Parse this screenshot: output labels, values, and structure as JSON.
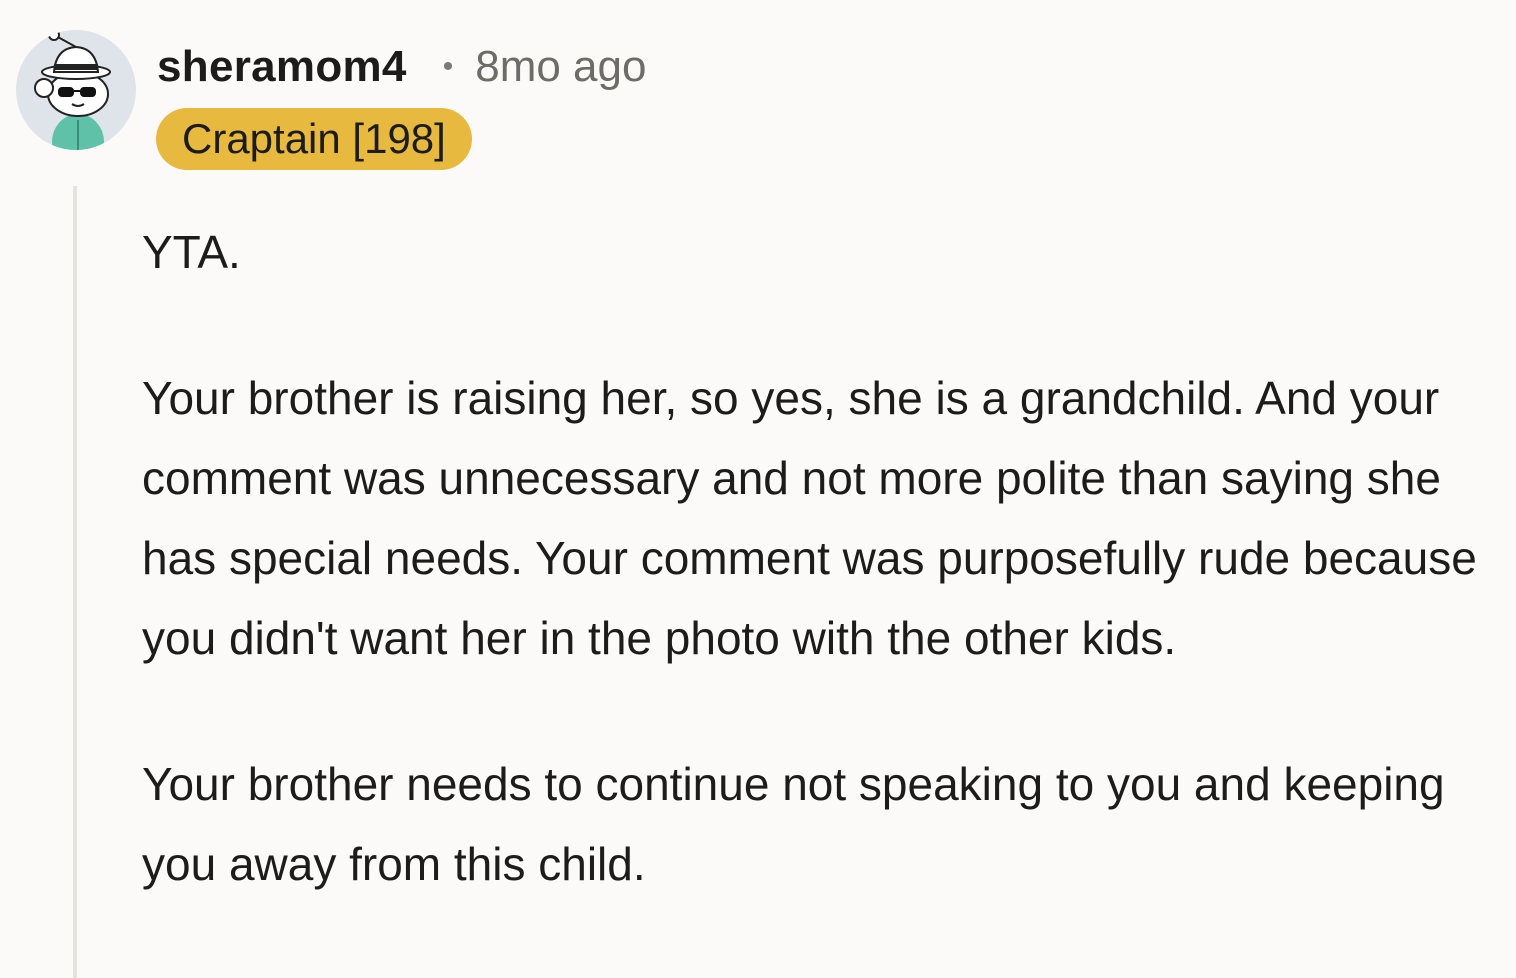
{
  "comment": {
    "author": "sheramom4",
    "separator": "•",
    "timestamp": "8mo ago",
    "flair": "Craptain [198]",
    "avatar_icon": "snoo-avatar-fedora-sunglasses",
    "body": [
      "YTA.",
      "Your brother is raising her, so yes, she is a grandchild. And your comment was unnecessary and not more polite than saying she has special needs. Your comment was purposefully rude because you didn't want her in the photo with the other kids.",
      "Your brother needs to continue not speaking to you and keeping you away from this child."
    ]
  },
  "colors": {
    "background": "#fbfaf8",
    "flair_bg": "#e7b93e",
    "thread_line": "#e6e2dc",
    "timestamp": "#6f6b66"
  }
}
